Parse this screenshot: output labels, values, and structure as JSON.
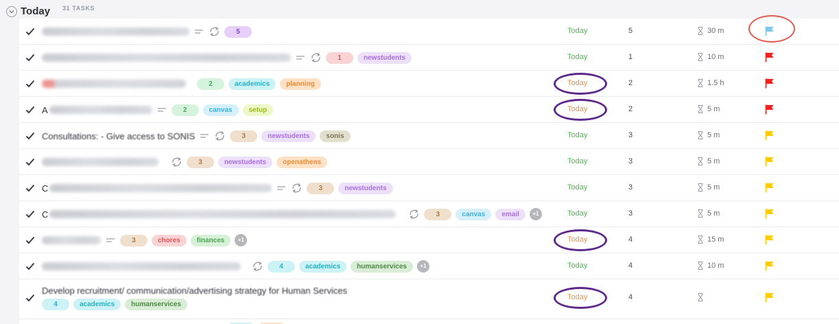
{
  "group": {
    "title": "Today",
    "count": "31 TASKS"
  },
  "colors": {
    "due_green": "#4fb94f",
    "due_orange": "#e8934d",
    "flag_red": "#f0211f",
    "flag_yellow": "#ffcc00",
    "flag_blue": "#7fc7ec",
    "annotation_purple": "#5d2a8c",
    "annotation_red": "#e05a52"
  },
  "tags": {
    "newstudents": "newstudents",
    "academics": "academics",
    "planning": "planning",
    "canvas": "canvas",
    "setup": "setup",
    "sonis": "sonis",
    "openathens": "openathens",
    "email": "email",
    "chores": "chores",
    "finances": "finances",
    "humanservices": "humanservices"
  },
  "rows": [
    {
      "points_tag": "5",
      "due": "Today",
      "points": "5",
      "estimate": "30 m",
      "priority": "low"
    },
    {
      "points_tag": "1",
      "due": "Today",
      "points": "1",
      "estimate": "10 m",
      "priority": "urgent"
    },
    {
      "points_tag": "2",
      "due": "Today",
      "points": "2",
      "estimate": "1.5 h",
      "priority": "urgent"
    },
    {
      "name_visible": "A",
      "points_tag": "2",
      "due": "Today",
      "points": "2",
      "estimate": "5 m",
      "priority": "urgent"
    },
    {
      "name_visible": "Consultations: - Give access to SONIS",
      "points_tag": "3",
      "due": "Today",
      "points": "3",
      "estimate": "5 m",
      "priority": "high"
    },
    {
      "points_tag": "3",
      "due": "Today",
      "points": "3",
      "estimate": "5 m",
      "priority": "high"
    },
    {
      "name_visible": "C",
      "points_tag": "3",
      "due": "Today",
      "points": "3",
      "estimate": "5 m",
      "priority": "high"
    },
    {
      "name_visible": "C",
      "points_tag": "3",
      "more": "+1",
      "due": "Today",
      "points": "3",
      "estimate": "5 m",
      "priority": "high"
    },
    {
      "points_tag": "3",
      "more": "+1",
      "due": "Today",
      "points": "4",
      "estimate": "15 m",
      "priority": "high"
    },
    {
      "points_tag": "4",
      "more": "+1",
      "due": "Today",
      "points": "4",
      "estimate": "10 m",
      "priority": "high"
    },
    {
      "name_visible": "Develop recruitment/ communication/advertising strategy for Human Services",
      "points_tag": "4",
      "due": "Today",
      "points": "4",
      "estimate": "",
      "priority": "high"
    }
  ]
}
